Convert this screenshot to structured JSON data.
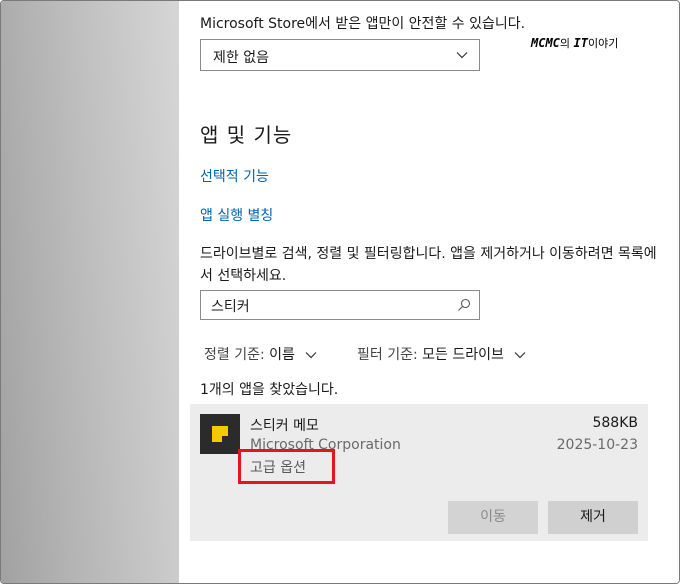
{
  "store_text": "Microsoft Store에서 받은 앱만이 안전할 수 있습니다.",
  "source_select": {
    "value": "제한 없음"
  },
  "watermark": {
    "part1": "MCMC",
    "part2": "의 ",
    "part3": "IT",
    "part4": "이야기"
  },
  "section_title": "앱 및 기능",
  "links": {
    "optional_features": "선택적 기능",
    "app_aliases": "앱 실행 별칭"
  },
  "description": "드라이브별로 검색, 정렬 및 필터링합니다. 앱을 제거하거나 이동하려면 목록에서 선택하세요.",
  "search": {
    "value": "스티커"
  },
  "sort": {
    "label": "정렬 기준:",
    "value": "이름"
  },
  "filter": {
    "label": "필터 기준:",
    "value": "모든 드라이브"
  },
  "found_text": "1개의 앱을 찾았습니다.",
  "app": {
    "name": "스티커 메모",
    "publisher": "Microsoft Corporation",
    "advanced_options": "고급 옵션",
    "size": "588KB",
    "date": "2025-10-23",
    "icon": "sticky-notes-icon",
    "icon_color": "#f5c800"
  },
  "buttons": {
    "move": "이동",
    "remove": "제거"
  },
  "colors": {
    "link": "#0063b1",
    "highlight": "#e8141b",
    "card_bg": "#ececec"
  }
}
